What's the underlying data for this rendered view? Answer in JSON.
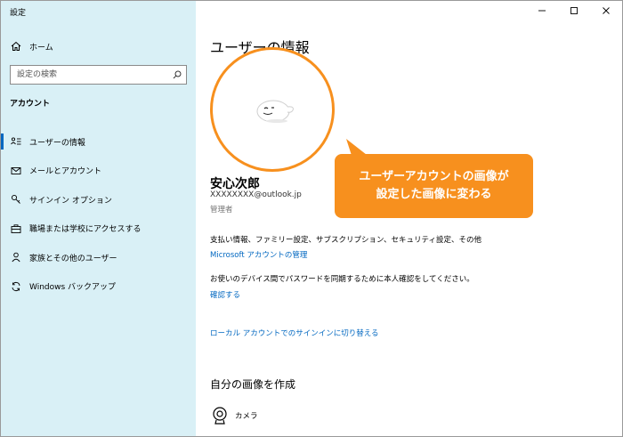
{
  "window": {
    "title": "設定"
  },
  "sidebar": {
    "home_label": "ホーム",
    "search_placeholder": "設定の検索",
    "section_heading": "アカウント",
    "items": [
      {
        "label": "ユーザーの情報",
        "icon": "user-info-icon",
        "active": true
      },
      {
        "label": "メールとアカウント",
        "icon": "mail-icon"
      },
      {
        "label": "サインイン オプション",
        "icon": "key-icon"
      },
      {
        "label": "職場または学校にアクセスする",
        "icon": "briefcase-icon"
      },
      {
        "label": "家族とその他のユーザー",
        "icon": "person-icon"
      },
      {
        "label": "Windows バックアップ",
        "icon": "sync-icon"
      }
    ]
  },
  "main": {
    "title": "ユーザーの情報",
    "user_name": "安心次郎",
    "user_email": "XXXXXXXX@outlook.jp",
    "user_role": "管理者",
    "billing_text": "支払い情報、ファミリー設定、サブスクリプション、セキュリティ設定、その他",
    "manage_account_link": "Microsoft アカウントの管理",
    "sync_text": "お使いのデバイス間でパスワードを同期するために本人確認をしてください。",
    "verify_link": "確認する",
    "local_account_link": "ローカル アカウントでのサインインに切り替える",
    "create_picture_heading": "自分の画像を作成",
    "camera_label": "カメラ"
  },
  "callout": {
    "line1": "ユーザーアカウントの画像が",
    "line2": "設定した画像に変わる"
  },
  "colors": {
    "accent": "#0067c0",
    "sidebar_bg": "#d9f0f6",
    "callout": "#f7901e"
  }
}
